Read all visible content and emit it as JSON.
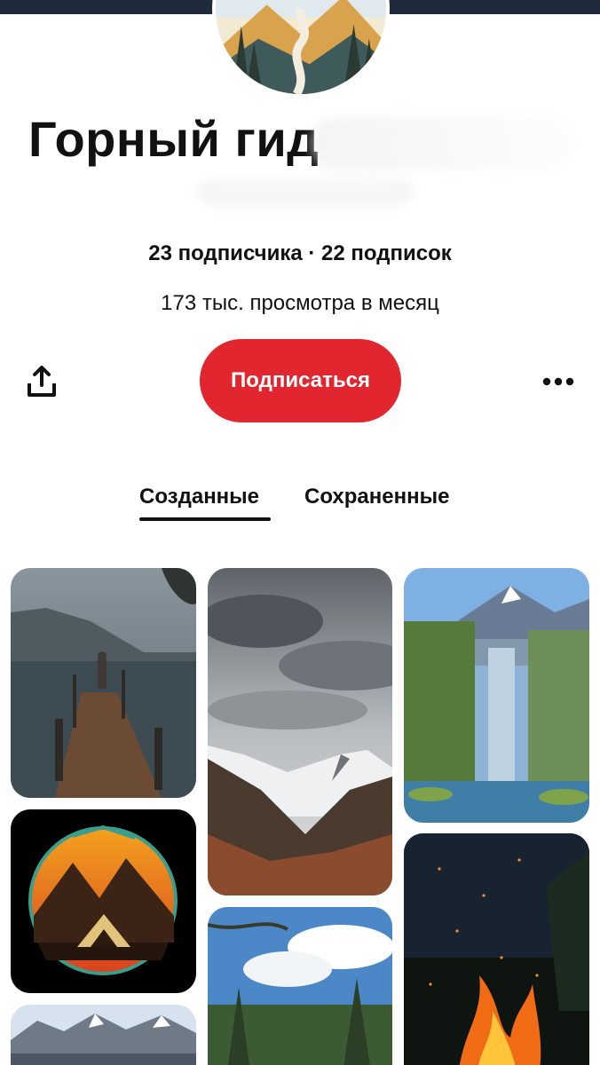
{
  "profile": {
    "name": "Горный гид",
    "stats_line": "23 подписчика · 22 подписок",
    "followers": "23 подписчика",
    "following": "22 подписок",
    "monthly_views": "173 тыс. просмотра в месяц"
  },
  "actions": {
    "share_icon": "share-upload-icon",
    "subscribe_label": "Подписаться",
    "more_icon": "more-dots-icon"
  },
  "tabs": [
    {
      "label": "Созданные",
      "active": true
    },
    {
      "label": "Сохраненные",
      "active": false
    }
  ],
  "colors": {
    "accent": "#e1262f",
    "text": "#111111",
    "background": "#ffffff"
  },
  "pins": [
    {
      "subject": "lake-pier-image"
    },
    {
      "subject": "snowy-mountain-forest-image"
    },
    {
      "subject": "waterfall-painting-image"
    },
    {
      "subject": "camping-emblem-image"
    },
    {
      "subject": "campfire-sparks-image"
    },
    {
      "subject": "forest-clouds-image"
    },
    {
      "subject": "mountain-range-image"
    }
  ]
}
